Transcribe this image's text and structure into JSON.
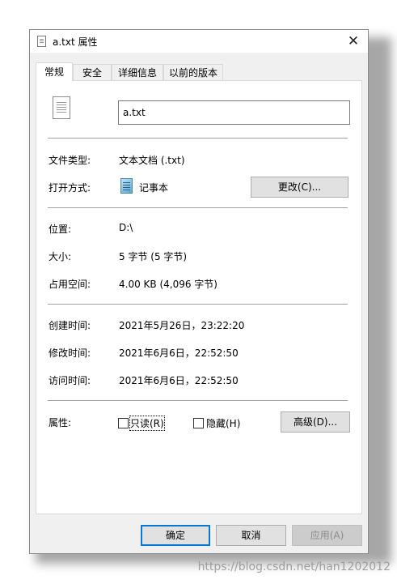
{
  "window": {
    "title": "a.txt 属性",
    "close_glyph": "✕"
  },
  "tabs": [
    {
      "label": "常规",
      "active": true
    },
    {
      "label": "安全",
      "active": false
    },
    {
      "label": "详细信息",
      "active": false
    },
    {
      "label": "以前的版本",
      "active": false
    }
  ],
  "general": {
    "file_name": "a.txt",
    "file_type": {
      "label": "文件类型:",
      "value": "文本文档 (.txt)"
    },
    "opens_with": {
      "label": "打开方式:",
      "value": "记事本",
      "change_button": "更改(C)..."
    },
    "location": {
      "label": "位置:",
      "value": "D:\\"
    },
    "size": {
      "label": "大小:",
      "value": "5 字节 (5 字节)"
    },
    "size_on_disk": {
      "label": "占用空间:",
      "value": "4.00 KB (4,096 字节)"
    },
    "created": {
      "label": "创建时间:",
      "value": "2021年5月26日，23:22:20"
    },
    "modified": {
      "label": "修改时间:",
      "value": "2021年6月6日，22:52:50"
    },
    "accessed": {
      "label": "访问时间:",
      "value": "2021年6月6日，22:52:50"
    },
    "attributes": {
      "label": "属性:",
      "readonly": {
        "label": "只读(R)",
        "checked": false
      },
      "hidden": {
        "label": "隐藏(H)",
        "checked": false
      },
      "advanced_button": "高级(D)..."
    }
  },
  "footer": {
    "ok": "确定",
    "cancel": "取消",
    "apply": "应用(A)"
  },
  "watermark": "https://blog.csdn.net/han1202012",
  "colors": {
    "accent": "#0078d7",
    "dialog_bg": "#f0f0f0",
    "panel_bg": "#ffffff"
  }
}
